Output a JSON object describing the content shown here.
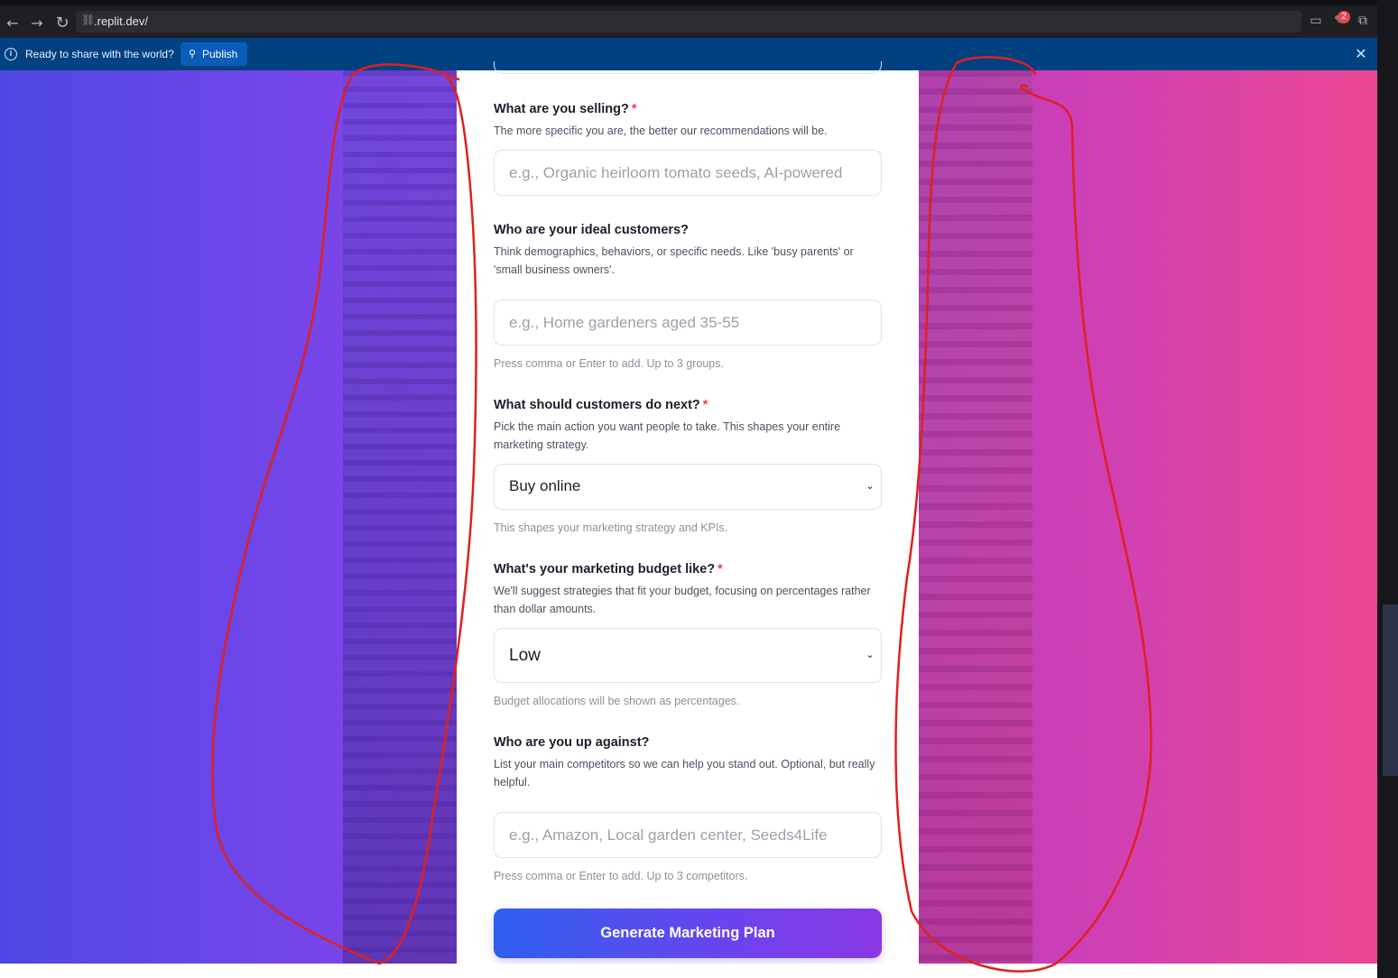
{
  "browser": {
    "url": ".replit.dev/",
    "notification_count": "2",
    "icons": [
      "back-arrow-icon",
      "forward-arrow-icon",
      "reload-icon",
      "link-icon",
      "devices-icon",
      "tools-icon",
      "open-external-icon"
    ]
  },
  "banner": {
    "message": "Ready to share with the world?",
    "publish_label": "Publish",
    "colors": {
      "background": "#004182",
      "button": "#0a5cb8"
    }
  },
  "form": {
    "selling": {
      "label": "What are you selling?",
      "required": "*",
      "help": "The more specific you are, the better our recommendations will be.",
      "placeholder": "e.g., Organic heirloom tomato seeds, AI-powered"
    },
    "customers": {
      "label": "Who are your ideal customers?",
      "help": "Think demographics, behaviors, or specific needs. Like 'busy parents' or 'small business owners'.",
      "placeholder": "e.g., Home gardeners aged 35-55",
      "note": "Press comma or Enter to add. Up to 3 groups."
    },
    "next_action": {
      "label": "What should customers do next?",
      "required": "*",
      "help": "Pick the main action you want people to take. This shapes your entire marketing strategy.",
      "selected": "Buy online",
      "note": "This shapes your marketing strategy and KPIs."
    },
    "budget": {
      "label": "What's your marketing budget like?",
      "required": "*",
      "help": "We'll suggest strategies that fit your budget, focusing on percentages rather than dollar amounts.",
      "selected": "Low",
      "note": "Budget allocations will be shown as percentages."
    },
    "competitors": {
      "label": "Who are you up against?",
      "help": "List your main competitors so we can help you stand out. Optional, but really helpful.",
      "placeholder": "e.g., Amazon, Local garden center, Seeds4Life",
      "note": "Press comma or Enter to add. Up to 3 competitors."
    },
    "submit_label": "Generate Marketing Plan",
    "colors": {
      "required": "#ef4444",
      "button_start": "#2f5ff0",
      "button_end": "#8b38e4"
    }
  },
  "background": {
    "colors": {
      "left": "#4e47e5",
      "middle": "#a041d6",
      "right": "#ec4794"
    }
  },
  "annotation": {
    "color": "#e0201f"
  }
}
